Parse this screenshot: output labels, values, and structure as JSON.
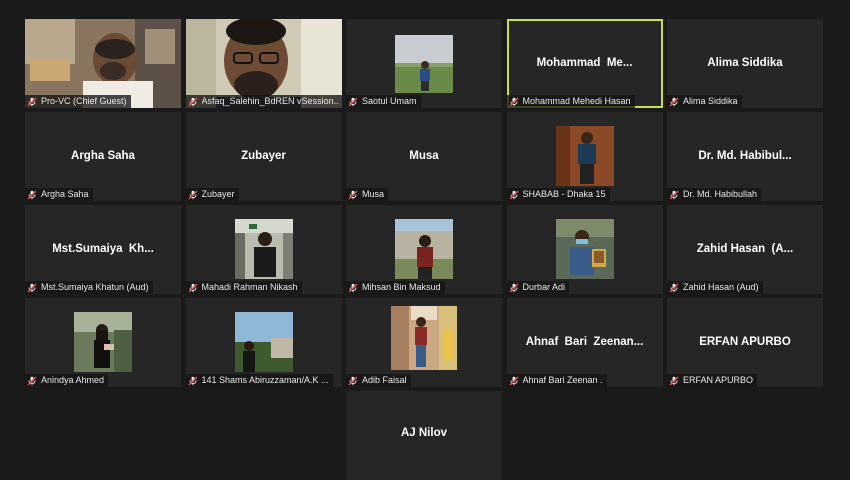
{
  "participants": [
    {
      "display": "",
      "label": "Pro-VC (Chief Guest)",
      "video": "room-man"
    },
    {
      "display": "",
      "label": "Asfaq_Salehin_BdREN vSession...",
      "video": "glasses-man"
    },
    {
      "display": "",
      "label": "Saotul Umam",
      "video": "field-person"
    },
    {
      "display": "Mohammad  Me...",
      "label": "Mohammad Mehedi Hasan",
      "active": true
    },
    {
      "display": "Alima Siddika",
      "label": "Alima Siddika"
    },
    {
      "display": "Argha Saha",
      "label": "Argha Saha"
    },
    {
      "display": "Zubayer",
      "label": "Zubayer"
    },
    {
      "display": "Musa",
      "label": "Musa"
    },
    {
      "display": "",
      "label": "SHABAB - Dhaka 15",
      "video": "brown-wall-person"
    },
    {
      "display": "Dr. Md. Habibul...",
      "label": "Dr. Md. Habibullah"
    },
    {
      "display": "Mst.Sumaiya  Kh...",
      "label": "Mst.Sumaiya Khatun (Aud)"
    },
    {
      "display": "",
      "label": "Mahadi Rahman Nikash",
      "video": "gate-person"
    },
    {
      "display": "",
      "label": "Mihsan Bin Maksud",
      "video": "building-person"
    },
    {
      "display": "",
      "label": "Durbar Adi",
      "video": "award-person"
    },
    {
      "display": "Zahid Hasan  (A...",
      "label": "Zahid Hasan (Aud)"
    },
    {
      "display": "",
      "label": "Anindya Ahmed",
      "video": "woman-outdoor"
    },
    {
      "display": "",
      "label": "141 Shams Abiruzzaman/A.K ...",
      "video": "sky-person"
    },
    {
      "display": "",
      "label": "Adib Faisal",
      "video": "shop-person"
    },
    {
      "display": "Ahnaf  Bari  Zeenan...",
      "label": "Ahnaf Bari Zeenan ."
    },
    {
      "display": "ERFAN APURBO",
      "label": "ERFAN APURBO"
    },
    {
      "display": "AJ Nilov",
      "label": "",
      "last": true
    }
  ],
  "colors": {
    "active_border": "#c8e04a",
    "tile_bg": "#262626",
    "mute": "#d9534f"
  },
  "icons": {
    "mute": "muted-microphone-icon"
  }
}
